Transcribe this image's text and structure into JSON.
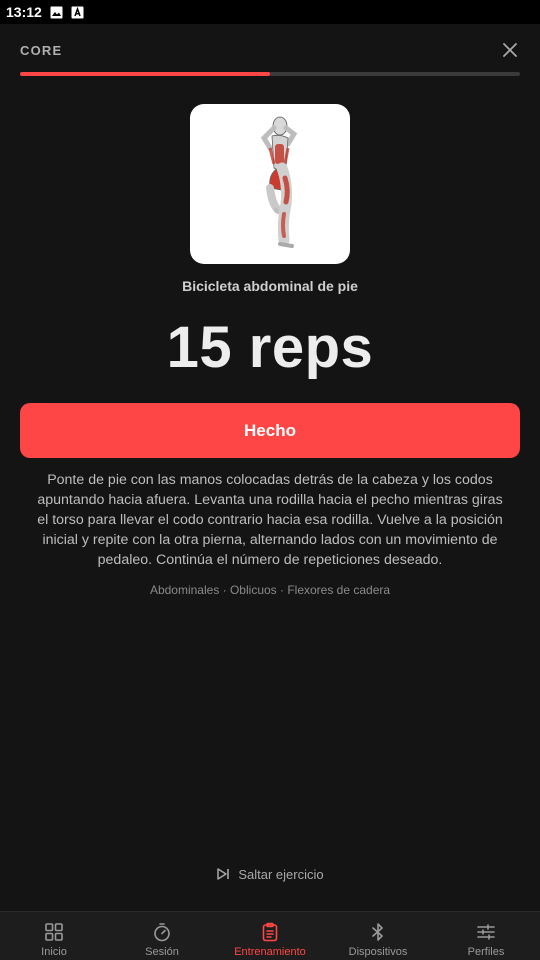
{
  "status_bar": {
    "time": "13:12"
  },
  "header": {
    "title": "CORE",
    "close_icon": "close-icon"
  },
  "progress": {
    "fraction": 0.5,
    "color": "#ff4646"
  },
  "exercise": {
    "name": "Bicicleta abdominal de pie",
    "reps": "15 reps",
    "done_label": "Hecho",
    "description": "Ponte de pie con las manos colocadas detrás de la cabeza y los codos apuntando hacia afuera. Levanta una rodilla hacia el pecho mientras giras el torso para llevar el codo contrario hacia esa rodilla. Vuelve a la posición inicial y repite con la otra pierna, alternando lados con un movimiento de pedaleo. Continúa el número de repeticiones deseado.",
    "muscles": "Abdominales · Oblicuos · Flexores de cadera"
  },
  "skip": {
    "label": "Saltar ejercicio",
    "icon": "skip-next-icon"
  },
  "nav": {
    "items": [
      {
        "label": "Inicio",
        "icon": "grid-icon",
        "active": false
      },
      {
        "label": "Sesión",
        "icon": "stopwatch-icon",
        "active": false
      },
      {
        "label": "Entrenamiento",
        "icon": "clipboard-icon",
        "active": true
      },
      {
        "label": "Dispositivos",
        "icon": "bluetooth-icon",
        "active": false
      },
      {
        "label": "Perfiles",
        "icon": "sliders-icon",
        "active": false
      }
    ]
  },
  "colors": {
    "accent": "#ff4646",
    "background": "#141414",
    "nav_background": "#1d1d1d"
  }
}
